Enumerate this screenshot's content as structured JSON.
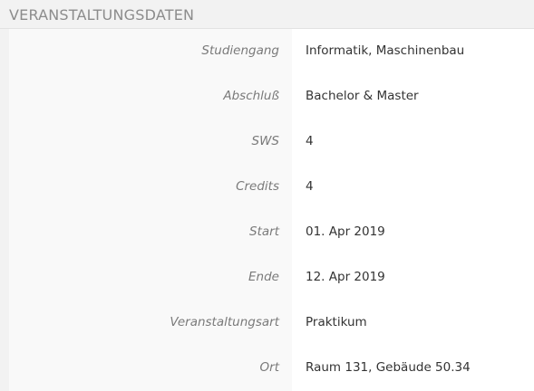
{
  "section": {
    "title": "VERANSTALTUNGSDATEN"
  },
  "rows": [
    {
      "label": "Studiengang",
      "value": "Informatik, Maschinenbau"
    },
    {
      "label": "Abschluß",
      "value": "Bachelor & Master"
    },
    {
      "label": "SWS",
      "value": "4"
    },
    {
      "label": "Credits",
      "value": "4"
    },
    {
      "label": "Start",
      "value": "01. Apr 2019"
    },
    {
      "label": "Ende",
      "value": "12. Apr 2019"
    },
    {
      "label": "Veranstaltungsart",
      "value": "Praktikum"
    },
    {
      "label": "Ort",
      "value": "Raum 131, Gebäude 50.34"
    }
  ]
}
